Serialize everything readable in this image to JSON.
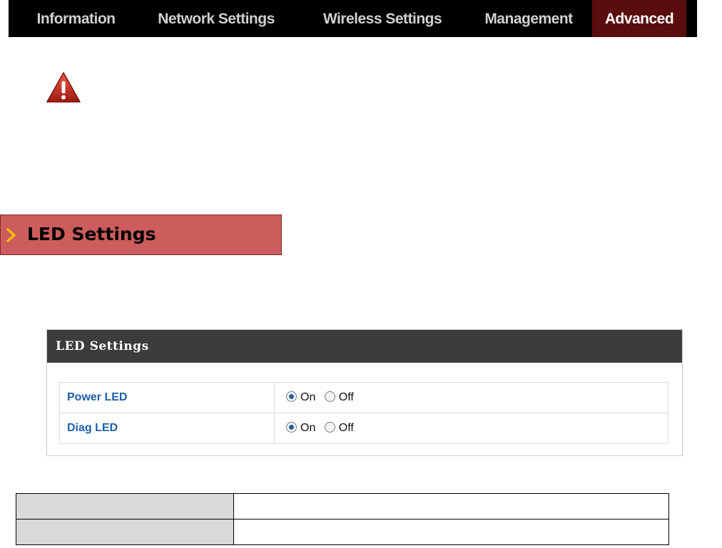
{
  "nav": {
    "tabs": [
      {
        "label": "Information",
        "active": false
      },
      {
        "label": "Network Settings",
        "active": false
      },
      {
        "label": "Wireless Settings",
        "active": false
      },
      {
        "label": "Management",
        "active": false
      },
      {
        "label": "Advanced",
        "active": true
      }
    ],
    "active_color": "#5a0d0d"
  },
  "warning": {
    "icon": "warning-triangle-icon",
    "color": "#c0392b"
  },
  "banner": {
    "title": "LED Settings",
    "icon": "chevron-right-icon",
    "color": "#cd5c5c"
  },
  "panel": {
    "title": "LED Settings",
    "rows": [
      {
        "label": "Power LED",
        "options": [
          "On",
          "Off"
        ],
        "selected": "On"
      },
      {
        "label": "Diag LED",
        "options": [
          "On",
          "Off"
        ],
        "selected": "On"
      }
    ]
  },
  "description_table": {
    "rows": [
      {
        "term": "",
        "description": ""
      },
      {
        "term": "",
        "description": ""
      }
    ]
  }
}
